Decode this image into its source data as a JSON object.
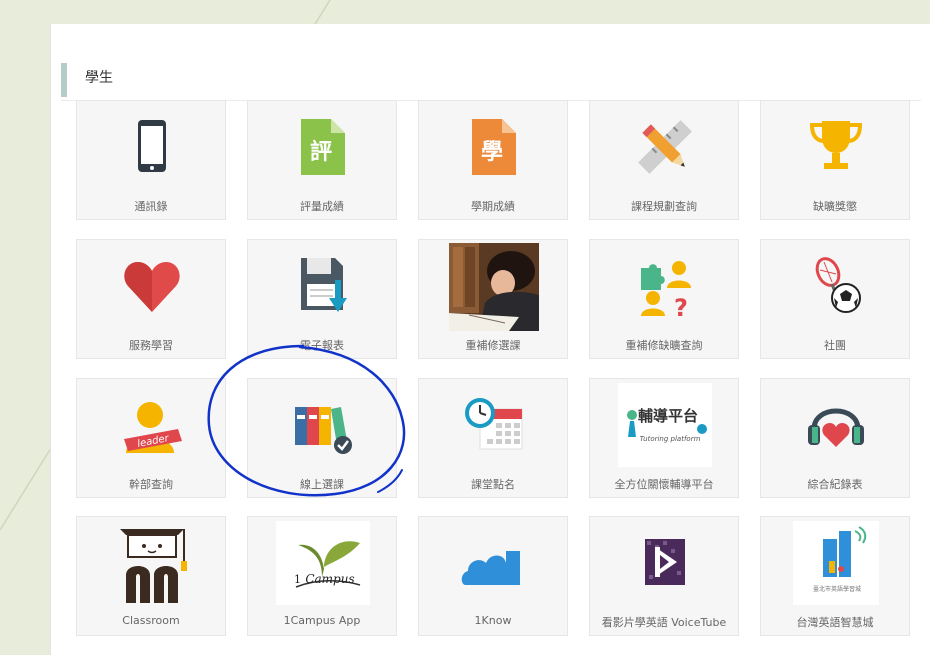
{
  "section": {
    "title": "學生"
  },
  "tiles": [
    {
      "label": "通訊錄",
      "icon": "phone-icon"
    },
    {
      "label": "評量成績",
      "icon": "grade-document-icon"
    },
    {
      "label": "學期成績",
      "icon": "semester-document-icon"
    },
    {
      "label": "課程規劃查詢",
      "icon": "pencil-ruler-icon"
    },
    {
      "label": "缺曠獎懲",
      "icon": "trophy-icon"
    },
    {
      "label": "服務學習",
      "icon": "heart-icon"
    },
    {
      "label": "電子報表",
      "icon": "floppy-download-icon"
    },
    {
      "label": "重補修選課",
      "icon": "student-studying-photo"
    },
    {
      "label": "重補修缺曠查詢",
      "icon": "puzzle-person-question-icon"
    },
    {
      "label": "社團",
      "icon": "racket-ball-icon"
    },
    {
      "label": "幹部查詢",
      "icon": "leader-icon",
      "badge": "leader"
    },
    {
      "label": "線上選課",
      "icon": "binders-check-icon"
    },
    {
      "label": "課堂點名",
      "icon": "clock-calendar-icon"
    },
    {
      "label": "全方位關懷輔導平台",
      "icon": "tutoring-platform-logo",
      "logo_text": "輔導平台",
      "logo_sub": "Tutoring platform"
    },
    {
      "label": "綜合紀錄表",
      "icon": "headphones-heart-icon"
    },
    {
      "label": "Classroom",
      "icon": "classroom-graduate-icon"
    },
    {
      "label": "1Campus App",
      "icon": "campus-leaf-logo",
      "logo_text": "Campus",
      "logo_prefix": "1"
    },
    {
      "label": "1Know",
      "icon": "cloud-icon"
    },
    {
      "label": "看影片學英語 VoiceTube",
      "icon": "voicetube-play-icon"
    },
    {
      "label": "台灣英語智慧城",
      "icon": "english-city-building-icon",
      "logo_sub": "臺北市英語學習城"
    }
  ],
  "colors": {
    "background": "#e8ecda",
    "panel": "#ffffff",
    "tile": "#f6f6f6",
    "section_bar": "#b5ccc8",
    "annotation": "#1233c9"
  }
}
